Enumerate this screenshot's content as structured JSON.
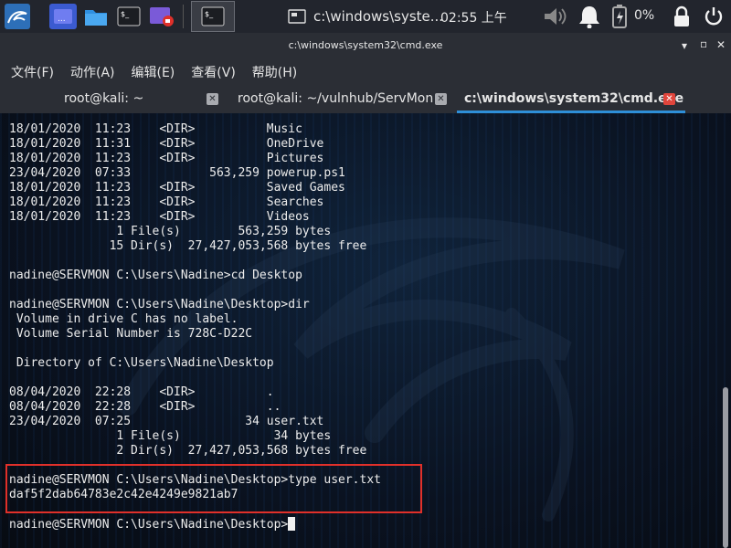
{
  "panel": {
    "window_title": "c:\\windows\\syste...",
    "clock": "02:55 上午",
    "battery": "0%"
  },
  "window": {
    "title": "c:\\windows\\system32\\cmd.exe"
  },
  "menu": [
    "文件(F)",
    "动作(A)",
    "编辑(E)",
    "查看(V)",
    "帮助(H)"
  ],
  "tabs": [
    {
      "label": "root@kali: ~"
    },
    {
      "label": "root@kali: ~/vulnhub/ServMon"
    },
    {
      "label": "c:\\windows\\system32\\cmd.exe"
    }
  ],
  "terminal": {
    "lines": [
      "18/01/2020  11:23    <DIR>          Music",
      "18/01/2020  11:31    <DIR>          OneDrive",
      "18/01/2020  11:23    <DIR>          Pictures",
      "23/04/2020  07:33           563,259 powerup.ps1",
      "18/01/2020  11:23    <DIR>          Saved Games",
      "18/01/2020  11:23    <DIR>          Searches",
      "18/01/2020  11:23    <DIR>          Videos",
      "               1 File(s)        563,259 bytes",
      "              15 Dir(s)  27,427,053,568 bytes free",
      "",
      "nadine@SERVMON C:\\Users\\Nadine>cd Desktop",
      "",
      "nadine@SERVMON C:\\Users\\Nadine\\Desktop>dir",
      " Volume in drive C has no label.",
      " Volume Serial Number is 728C-D22C",
      "",
      " Directory of C:\\Users\\Nadine\\Desktop",
      "",
      "08/04/2020  22:28    <DIR>          .",
      "08/04/2020  22:28    <DIR>          ..",
      "23/04/2020  07:25                34 user.txt",
      "               1 File(s)             34 bytes",
      "               2 Dir(s)  27,427,053,568 bytes free",
      "",
      "nadine@SERVMON C:\\Users\\Nadine\\Desktop>type user.txt",
      "daf5f2dab64783e2c42e4249e9821ab7",
      ""
    ],
    "prompt": "nadine@SERVMON C:\\Users\\Nadine\\Desktop>"
  }
}
